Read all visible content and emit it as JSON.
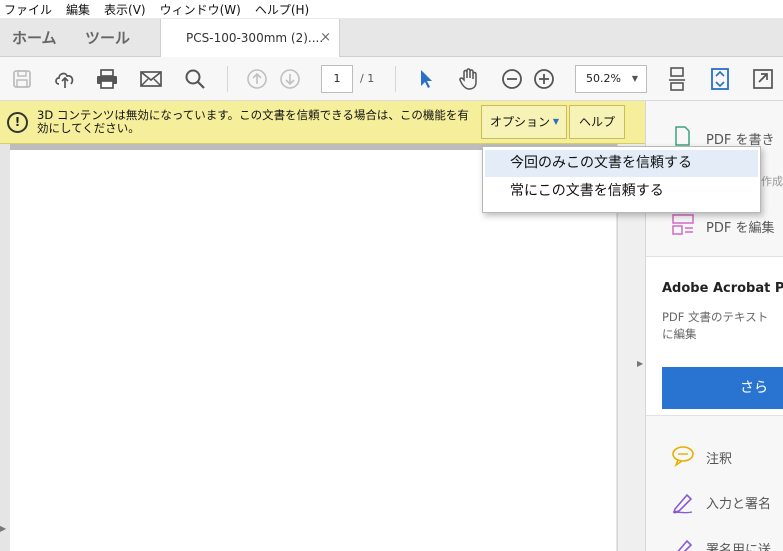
{
  "menubar": {
    "items": [
      "ファイル",
      "編集",
      "表示(V)",
      "ウィンドウ(W)",
      "ヘルプ(H)"
    ]
  },
  "tabs": {
    "home": "ホーム",
    "tools": "ツール",
    "document_title": "PCS-100-300mm (2)....",
    "close_symbol": "×"
  },
  "toolbar": {
    "page_current": "1",
    "page_total": "/ 1",
    "zoom": "50.2%",
    "icons": [
      "save-icon",
      "upload-icon",
      "print-icon",
      "mail-icon",
      "search-icon",
      "page-up-icon",
      "page-down-icon",
      "select-pointer-icon",
      "hand-icon",
      "zoom-out-icon",
      "zoom-in-icon",
      "scroll-mode-icon",
      "fit-page-icon",
      "fullscreen-icon"
    ]
  },
  "notification": {
    "message": "3D コンテンツは無効になっています。この文書を信頼できる場合は、この機能を有効にしてください。",
    "options_button": "オプション",
    "help_button": "ヘルプ"
  },
  "dropdown": {
    "items": [
      "今回のみこの文書を信頼する",
      "常にこの文書を信頼する"
    ]
  },
  "rightpane": {
    "item_create": "PDF を書き",
    "item_combine": "作成",
    "item_edit": "PDF を編集",
    "card_title": "Adobe Acrobat P",
    "card_desc_line1": "PDF 文書のテキスト",
    "card_desc_line2": "に編集",
    "card_button": "さら",
    "item_comment": "注釈",
    "item_fill_sign": "入力と署名",
    "item_more": "署名用に送"
  },
  "colors": {
    "notification_bg": "#f5ef9b",
    "accent_blue": "#2a74d1",
    "highlight": "#e3ecf7"
  }
}
